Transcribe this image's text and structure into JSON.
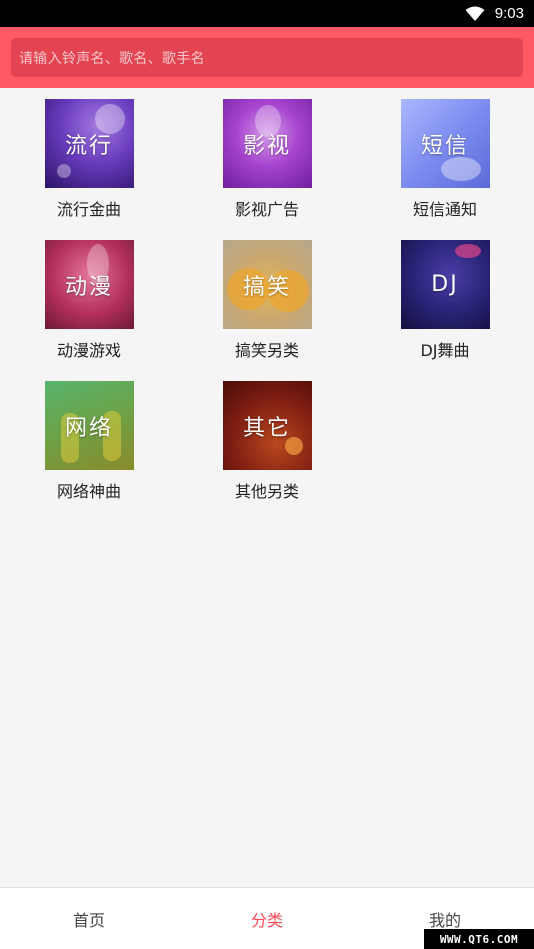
{
  "status_bar": {
    "time": "9:03",
    "icons": [
      "wifi-icon"
    ]
  },
  "search": {
    "placeholder": "请输入铃声名、歌名、歌手名"
  },
  "categories": [
    {
      "overlay": "流行",
      "label": "流行金曲"
    },
    {
      "overlay": "影视",
      "label": "影视广告"
    },
    {
      "overlay": "短信",
      "label": "短信通知"
    },
    {
      "overlay": "动漫",
      "label": "动漫游戏"
    },
    {
      "overlay": "搞笑",
      "label": "搞笑另类"
    },
    {
      "overlay": "DJ",
      "label": "DJ舞曲"
    },
    {
      "overlay": "网络",
      "label": "网络神曲"
    },
    {
      "overlay": "其它",
      "label": "其他另类"
    }
  ],
  "bottom_nav": {
    "items": [
      {
        "label": "首页"
      },
      {
        "label": "分类"
      },
      {
        "label": "我的"
      }
    ],
    "active_color": "#ff4a5a"
  },
  "watermark": "WWW.QT6.COM",
  "colors": {
    "header": "#ff5a64",
    "search_box": "#e44451",
    "background": "#f5f5f5"
  }
}
